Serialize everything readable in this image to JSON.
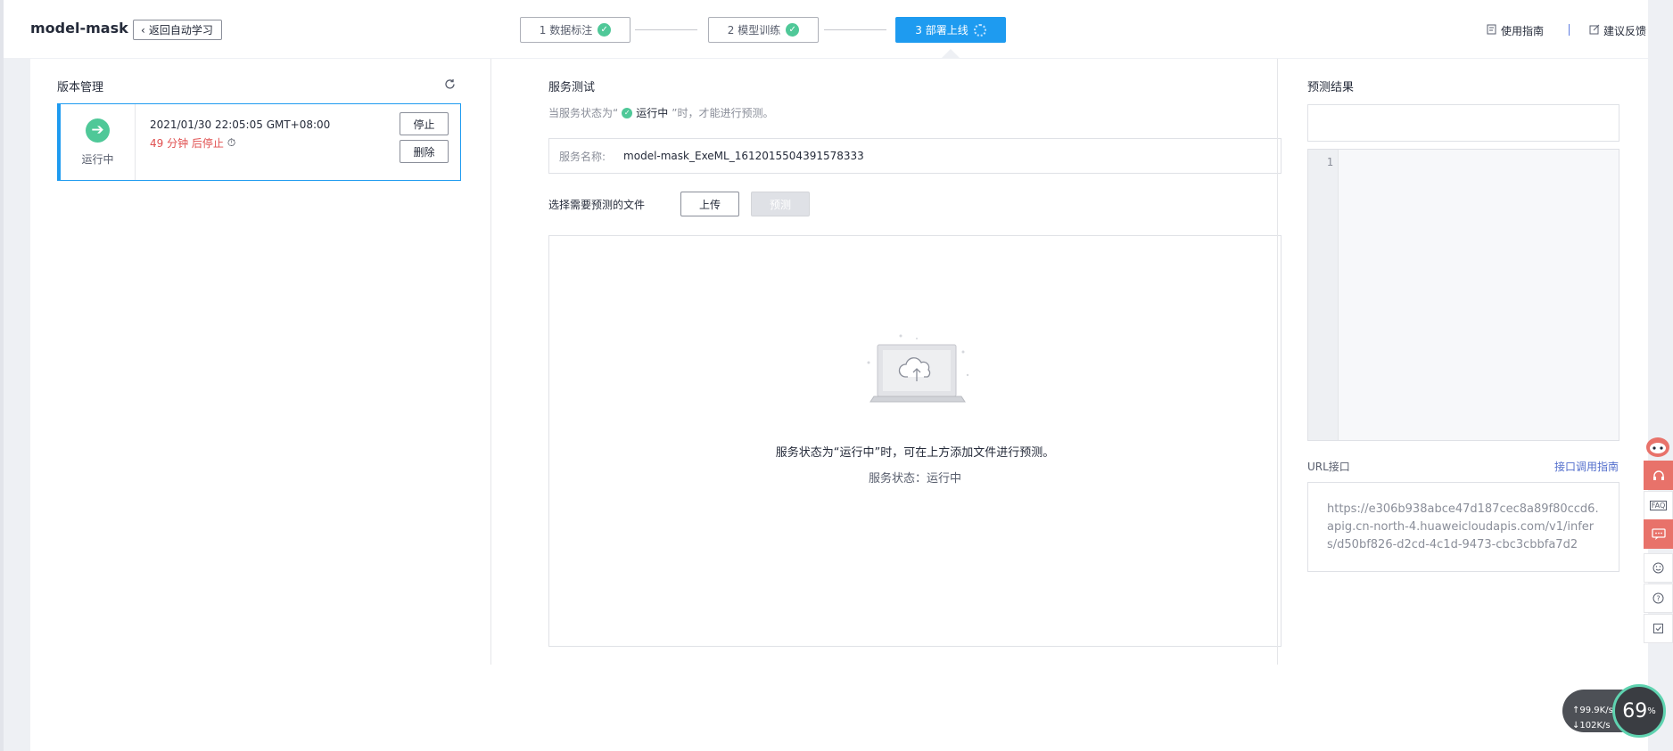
{
  "header": {
    "title": "model-mask",
    "back_label": "返回自动学习",
    "steps": [
      {
        "label": "1 数据标注",
        "state": "done"
      },
      {
        "label": "2 模型训练",
        "state": "done"
      },
      {
        "label": "3 部署上线",
        "state": "active"
      }
    ],
    "guide_label": "使用指南",
    "feedback_label": "建议反馈"
  },
  "version": {
    "title": "版本管理",
    "status": "运行中",
    "time": "2021/01/30 22:05:05 GMT+08:00",
    "countdown": "49 分钟 后停止",
    "stop_label": "停止",
    "delete_label": "删除"
  },
  "service": {
    "title": "服务测试",
    "hint_prefix": "当服务状态为“",
    "hint_status": "运行中",
    "hint_suffix": "”时，才能进行预测。",
    "name_label": "服务名称:",
    "name_value": "model-mask_ExeML_1612015504391578333",
    "select_label": "选择需要预测的文件",
    "upload_label": "上传",
    "predict_label": "预测",
    "drop_message": "服务状态为“运行中”时，可在上方添加文件进行预测。",
    "drop_status": "服务状态：运行中"
  },
  "result": {
    "title": "预测结果",
    "line_no": "1",
    "url_label": "URL接口",
    "url_guide": "接口调用指南",
    "url_value": "https://e306b938abce47d187cec8a89f80ccd6.apig.cn-north-4.huaweicloudapis.com/v1/infers/d50bf826-d2cd-4c1d-9473-cbc3cbbfa7d2"
  },
  "float_bar": {
    "faq_label": "FAQ"
  },
  "speed": {
    "upload": "↑99.9K/s",
    "download": "↓102K/s",
    "percent": "69",
    "percent_unit": "%"
  },
  "colors": {
    "accent": "#1e9bf0",
    "success": "#4fc898",
    "danger": "#e04f4f",
    "link": "#526ecc"
  }
}
